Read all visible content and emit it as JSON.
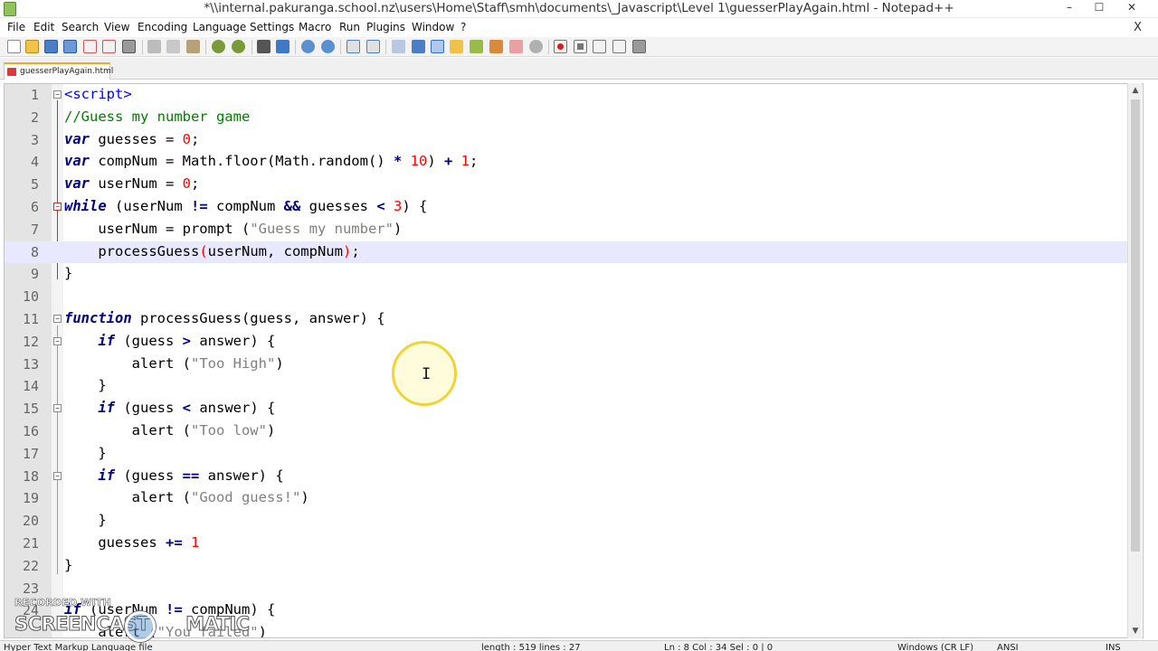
{
  "window": {
    "title": "*\\\\internal.pakuranga.school.nz\\users\\Home\\Staff\\smh\\documents\\_Javascript\\Level 1\\guesserPlayAgain.html - Notepad++",
    "minimize": "–",
    "maximize": "☐",
    "close": "✕"
  },
  "menu": {
    "items": [
      "File",
      "Edit",
      "Search",
      "View",
      "Encoding",
      "Language",
      "Settings",
      "Macro",
      "Run",
      "Plugins",
      "Window",
      "?"
    ],
    "close_glyph": "X"
  },
  "tab": {
    "label": "guesserPlayAgain.html"
  },
  "editor": {
    "line_numbers": [
      "1",
      "2",
      "3",
      "4",
      "5",
      "6",
      "7",
      "8",
      "9",
      "10",
      "11",
      "12",
      "13",
      "14",
      "15",
      "16",
      "17",
      "18",
      "19",
      "20",
      "21",
      "22",
      "23",
      "24"
    ],
    "current_line": 8
  },
  "status": {
    "file_type": "Hyper Text Markup Language file",
    "length": "length : 519    lines : 27",
    "position": "Ln : 8    Col : 34    Sel : 0 | 0",
    "eol": "Windows (CR LF)",
    "encoding": "ANSI",
    "mode": "INS"
  },
  "watermark": {
    "top": "RECORDED WITH",
    "main": "SCREENCAST",
    "suffix": "MATIC"
  },
  "icons": {
    "scroll_up": "▲",
    "scroll_down": "▼",
    "ibeam": "I",
    "toolbar": [
      "new-file-icon",
      "open-file-icon",
      "save-icon",
      "save-all-icon",
      "close-icon",
      "close-all-icon",
      "print-icon",
      "cut-icon",
      "copy-icon",
      "paste-icon",
      "undo-icon",
      "redo-icon",
      "find-icon",
      "replace-icon",
      "zoom-in-icon",
      "zoom-out-icon",
      "sync-v-icon",
      "sync-h-icon",
      "word-wrap-icon",
      "show-all-chars-icon",
      "indent-guide-icon",
      "udl-icon",
      "doc-map-icon",
      "function-list-icon",
      "folder-workspace-icon",
      "monitor-icon",
      "record-macro-icon",
      "stop-record-icon",
      "play-macro-icon",
      "run-macro-multiple-icon",
      "save-macro-icon"
    ]
  }
}
